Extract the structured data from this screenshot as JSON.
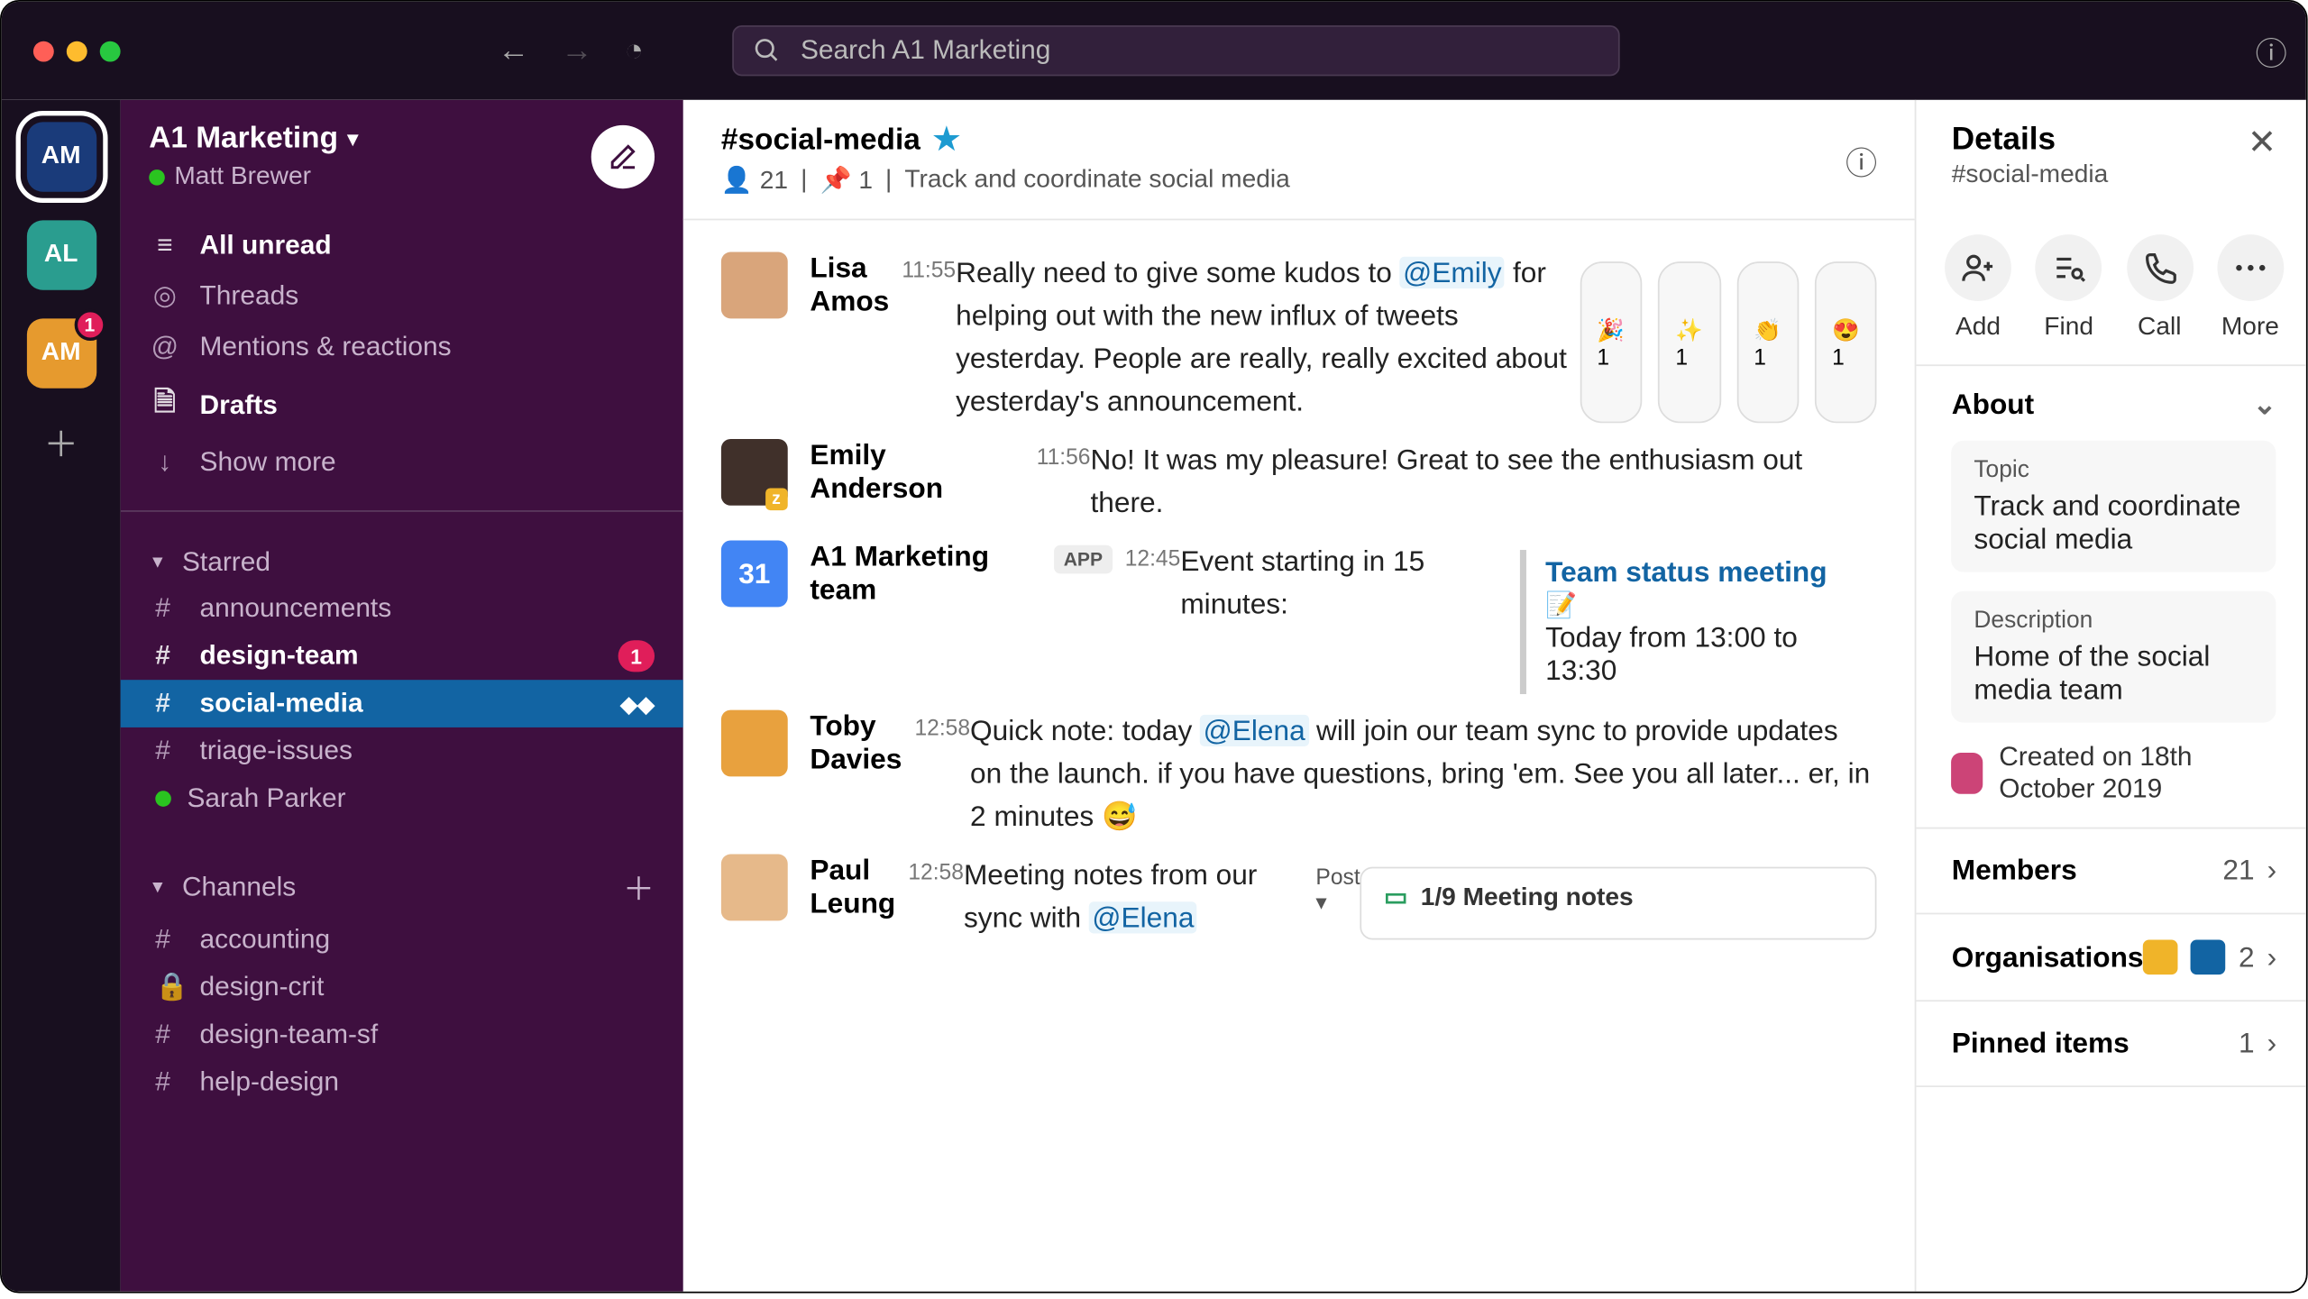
{
  "search_placeholder": "Search A1 Marketing",
  "workspaces": [
    {
      "initials": "AM",
      "active": true,
      "badge": null
    },
    {
      "initials": "AL",
      "cls": "teal",
      "badge": null
    },
    {
      "initials": "AM",
      "cls": "orange",
      "badge": "1"
    }
  ],
  "sidebar": {
    "workspace_name": "A1 Marketing",
    "user_name": "Matt Brewer",
    "nav": [
      {
        "icon": "≡",
        "label": "All unread",
        "bold": true
      },
      {
        "icon": "◎",
        "label": "Threads"
      },
      {
        "icon": "@",
        "label": "Mentions & reactions"
      },
      {
        "icon": "🗎",
        "label": "Drafts",
        "bold": true
      },
      {
        "icon": "↓",
        "label": "Show more"
      }
    ],
    "starred_label": "Starred",
    "starred": [
      {
        "prefix": "#",
        "label": "announcements"
      },
      {
        "prefix": "#",
        "label": "design-team",
        "unread": true,
        "badge": "1"
      },
      {
        "prefix": "#",
        "label": "social-media",
        "active": true,
        "ext": "◆◆"
      },
      {
        "prefix": "#",
        "label": "triage-issues"
      },
      {
        "prefix": "●",
        "label": "Sarah Parker",
        "presence": true
      }
    ],
    "channels_label": "Channels",
    "channels": [
      {
        "prefix": "#",
        "label": "accounting"
      },
      {
        "prefix": "🔒",
        "label": "design-crit"
      },
      {
        "prefix": "#",
        "label": "design-team-sf"
      },
      {
        "prefix": "#",
        "label": "help-design"
      }
    ]
  },
  "channel": {
    "name": "#social-media",
    "member_count": "21",
    "pin_count": "1",
    "topic": "Track and coordinate social media"
  },
  "messages": [
    {
      "name": "Lisa Amos",
      "time": "11:55",
      "avatar": "#d9a57b",
      "parts": [
        "Really need to give some kudos to ",
        {
          "mention": "@Emily"
        },
        " for helping out with the new influx of tweets yesterday. People are really, really excited about yesterday's announcement."
      ],
      "reactions": [
        {
          "e": "🎉",
          "c": "1"
        },
        {
          "e": "✨",
          "c": "1"
        },
        {
          "e": "👏",
          "c": "1"
        },
        {
          "e": "😍",
          "c": "1"
        }
      ]
    },
    {
      "name": "Emily Anderson",
      "time": "11:56",
      "avatar": "#40302a",
      "avatar_badge": "z",
      "parts": [
        "No! It was my pleasure! Great to see the enthusiasm out there."
      ]
    },
    {
      "name": "A1 Marketing team",
      "time": "12:45",
      "app": true,
      "cal": "31",
      "parts": [
        "Event starting in 15 minutes:"
      ],
      "event": {
        "title": "Team status meeting",
        "emoji": "📝",
        "when": "Today from 13:00 to 13:30"
      }
    },
    {
      "name": "Toby Davies",
      "time": "12:58",
      "avatar": "#e8a13e",
      "parts": [
        "Quick note: today ",
        {
          "mention": "@Elena"
        },
        " will join our team sync to provide updates on the launch. if you have questions, bring 'em. See you all later... er, in 2 minutes 😅"
      ]
    },
    {
      "name": "Paul Leung",
      "time": "12:58",
      "avatar": "#e6b98a",
      "parts": [
        "Meeting notes from our sync with ",
        {
          "mention": "@Elena"
        }
      ],
      "post_label": "Post ▾",
      "attachment": "1/9 Meeting notes"
    }
  ],
  "details": {
    "title": "Details",
    "subtitle": "#social-media",
    "actions": [
      {
        "icon": "add",
        "label": "Add"
      },
      {
        "icon": "find",
        "label": "Find"
      },
      {
        "icon": "call",
        "label": "Call"
      },
      {
        "icon": "more",
        "label": "More"
      }
    ],
    "about_label": "About",
    "topic_label": "Topic",
    "topic_value": "Track and coordinate social media",
    "desc_label": "Description",
    "desc_value": "Home of the social media team",
    "created_text": "Created on 18th October 2019",
    "members_label": "Members",
    "members_count": "21",
    "orgs_label": "Organisations",
    "orgs_count": "2",
    "pinned_label": "Pinned items",
    "pinned_count": "1"
  },
  "app_badge_text": "APP"
}
